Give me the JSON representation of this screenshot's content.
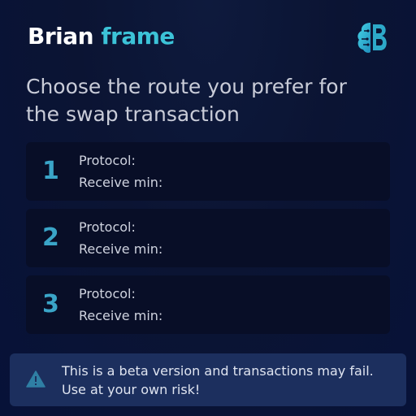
{
  "header": {
    "brand_word1": "Brian",
    "brand_word2": "frame",
    "logo_icon": "brain-b-logo-icon"
  },
  "heading": "Choose the route you prefer for the swap transaction",
  "routes": [
    {
      "number": "1",
      "protocol_label": "Protocol:",
      "receive_label": "Receive min:"
    },
    {
      "number": "2",
      "protocol_label": "Protocol:",
      "receive_label": "Receive min:"
    },
    {
      "number": "3",
      "protocol_label": "Protocol:",
      "receive_label": "Receive min:"
    }
  ],
  "warning": {
    "icon": "warning-triangle-icon",
    "text": "This is a beta version and transactions may fail. Use at your own risk!"
  },
  "colors": {
    "accent": "#3cc3d8",
    "number": "#3aa5c8",
    "background": "#0b1433",
    "card": "#080e27",
    "warning_bg": "#1c2f5e"
  }
}
